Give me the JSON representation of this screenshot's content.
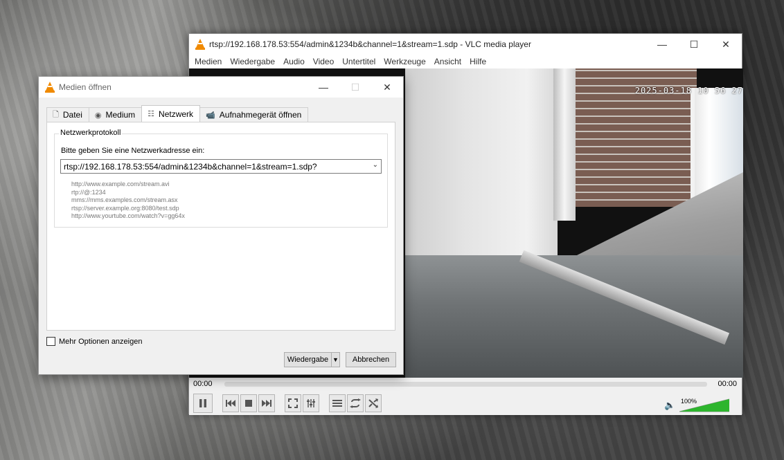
{
  "vlc": {
    "title": "rtsp://192.168.178.53:554/admin&1234b&channel=1&stream=1.sdp - VLC media player",
    "menu": [
      "Medien",
      "Wiedergabe",
      "Audio",
      "Video",
      "Untertitel",
      "Werkzeuge",
      "Ansicht",
      "Hilfe"
    ],
    "video_timestamp": "2025-03-18 10 56 27",
    "time_elapsed": "00:00",
    "time_total": "00:00",
    "volume_label": "100%",
    "volume_fraction": 1.0
  },
  "dialog": {
    "title": "Medien öffnen",
    "tabs": [
      {
        "label": "Datei",
        "icon": "file-icon"
      },
      {
        "label": "Medium",
        "icon": "disc-icon"
      },
      {
        "label": "Netzwerk",
        "icon": "network-icon",
        "active": true
      },
      {
        "label": "Aufnahmegerät öffnen",
        "icon": "capture-device-icon"
      }
    ],
    "group_title": "Netzwerkprotokoll",
    "prompt": "Bitte geben Sie eine Netzwerkadresse ein:",
    "url_value": "rtsp://192.168.178.53:554/admin&1234b&channel=1&stream=1.sdp?",
    "examples": [
      "http://www.example.com/stream.avi",
      "rtp://@:1234",
      "mms://mms.examples.com/stream.asx",
      "rtsp://server.example.org:8080/test.sdp",
      "http://www.yourtube.com/watch?v=gg64x"
    ],
    "more_options_label": "Mehr Optionen anzeigen",
    "more_options_checked": false,
    "play_button": "Wiedergabe",
    "cancel_button": "Abbrechen"
  },
  "colors": {
    "vlc_orange": "#f08a00",
    "volume_green": "#2db52d"
  }
}
